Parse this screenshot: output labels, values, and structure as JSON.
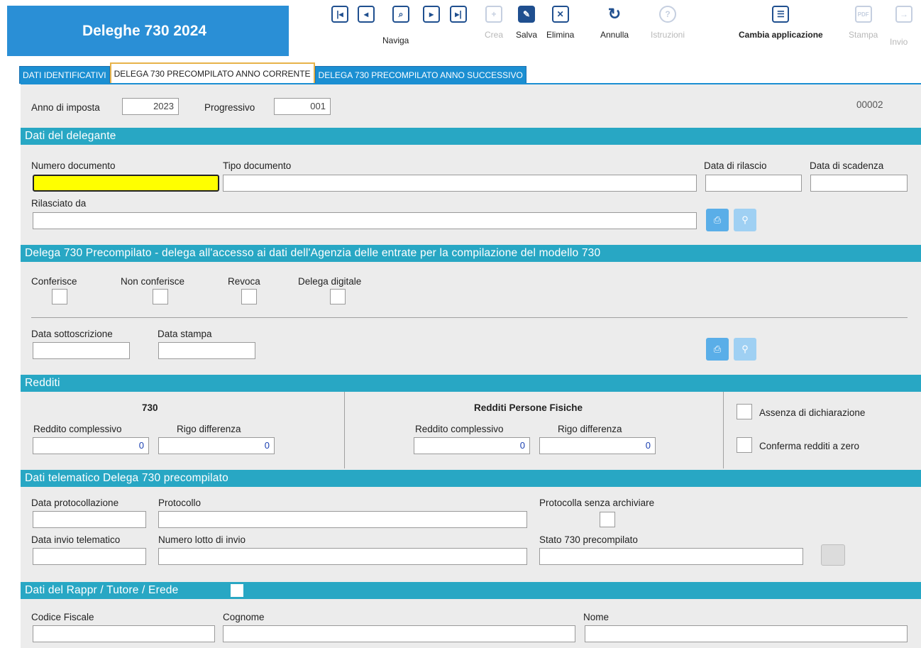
{
  "app": {
    "title": "Deleghe 730 2024"
  },
  "toolbar": {
    "naviga_label": "Naviga",
    "crea_label": "Crea",
    "salva_label": "Salva",
    "elimina_label": "Elimina",
    "annulla_label": "Annulla",
    "istruzioni_label": "Istruzioni",
    "cambia_label": "Cambia applicazione",
    "stampa_label": "Stampa",
    "invio_label": "Invio",
    "first_icon": "first-record-icon",
    "prev_icon": "previous-record-icon",
    "search_icon": "search-record-icon",
    "next_icon": "next-record-icon",
    "last_icon": "last-record-icon"
  },
  "tabs": [
    {
      "label": "DATI IDENTIFICATIVI"
    },
    {
      "label": "DELEGA 730 PRECOMPILATO ANNO CORRENTE"
    },
    {
      "label": "DELEGA 730 PRECOMPILATO ANNO SUCCESSIVO"
    }
  ],
  "header_fields": {
    "anno_label": "Anno di imposta",
    "anno_value": "2023",
    "progressivo_label": "Progressivo",
    "progressivo_value": "001",
    "record_code": "00002"
  },
  "delegante": {
    "title": "Dati del delegante",
    "numero_documento_label": "Numero documento",
    "tipo_documento_label": "Tipo documento",
    "data_rilascio_label": "Data di rilascio",
    "data_scadenza_label": "Data di scadenza",
    "rilasciato_da_label": "Rilasciato da"
  },
  "delega": {
    "title": "Delega 730 Precompilato - delega all'accesso ai dati dell'Agenzia delle entrate per la compilazione del modello 730",
    "conferisce_label": "Conferisce",
    "non_conferisce_label": "Non conferisce",
    "revoca_label": "Revoca",
    "delega_digitale_label": "Delega digitale",
    "data_sottoscrizione_label": "Data sottoscrizione",
    "data_stampa_label": "Data stampa"
  },
  "redditi": {
    "title": "Redditi",
    "col730_title": "730",
    "rpf_title": "Redditi Persone Fisiche",
    "reddito_complessivo_label": "Reddito complessivo",
    "rigo_differenza_label": "Rigo differenza",
    "v730_reddito": "0",
    "v730_rigo": "0",
    "rpf_reddito": "0",
    "rpf_rigo": "0",
    "assenza_label": "Assenza di dichiarazione",
    "conferma_label": "Conferma redditi a zero"
  },
  "telematico": {
    "title": "Dati telematico Delega 730 precompilato",
    "data_protocollazione_label": "Data protocollazione",
    "protocollo_label": "Protocollo",
    "protocolla_label": "Protocolla senza archiviare",
    "data_invio_label": "Data invio telematico",
    "numero_lotto_label": "Numero lotto di invio",
    "stato_label": "Stato 730 precompilato"
  },
  "rappr": {
    "title": "Dati del Rappr / Tutore / Erede",
    "codice_fiscale_label": "Codice Fiscale",
    "cognome_label": "Cognome",
    "nome_label": "Nome"
  }
}
